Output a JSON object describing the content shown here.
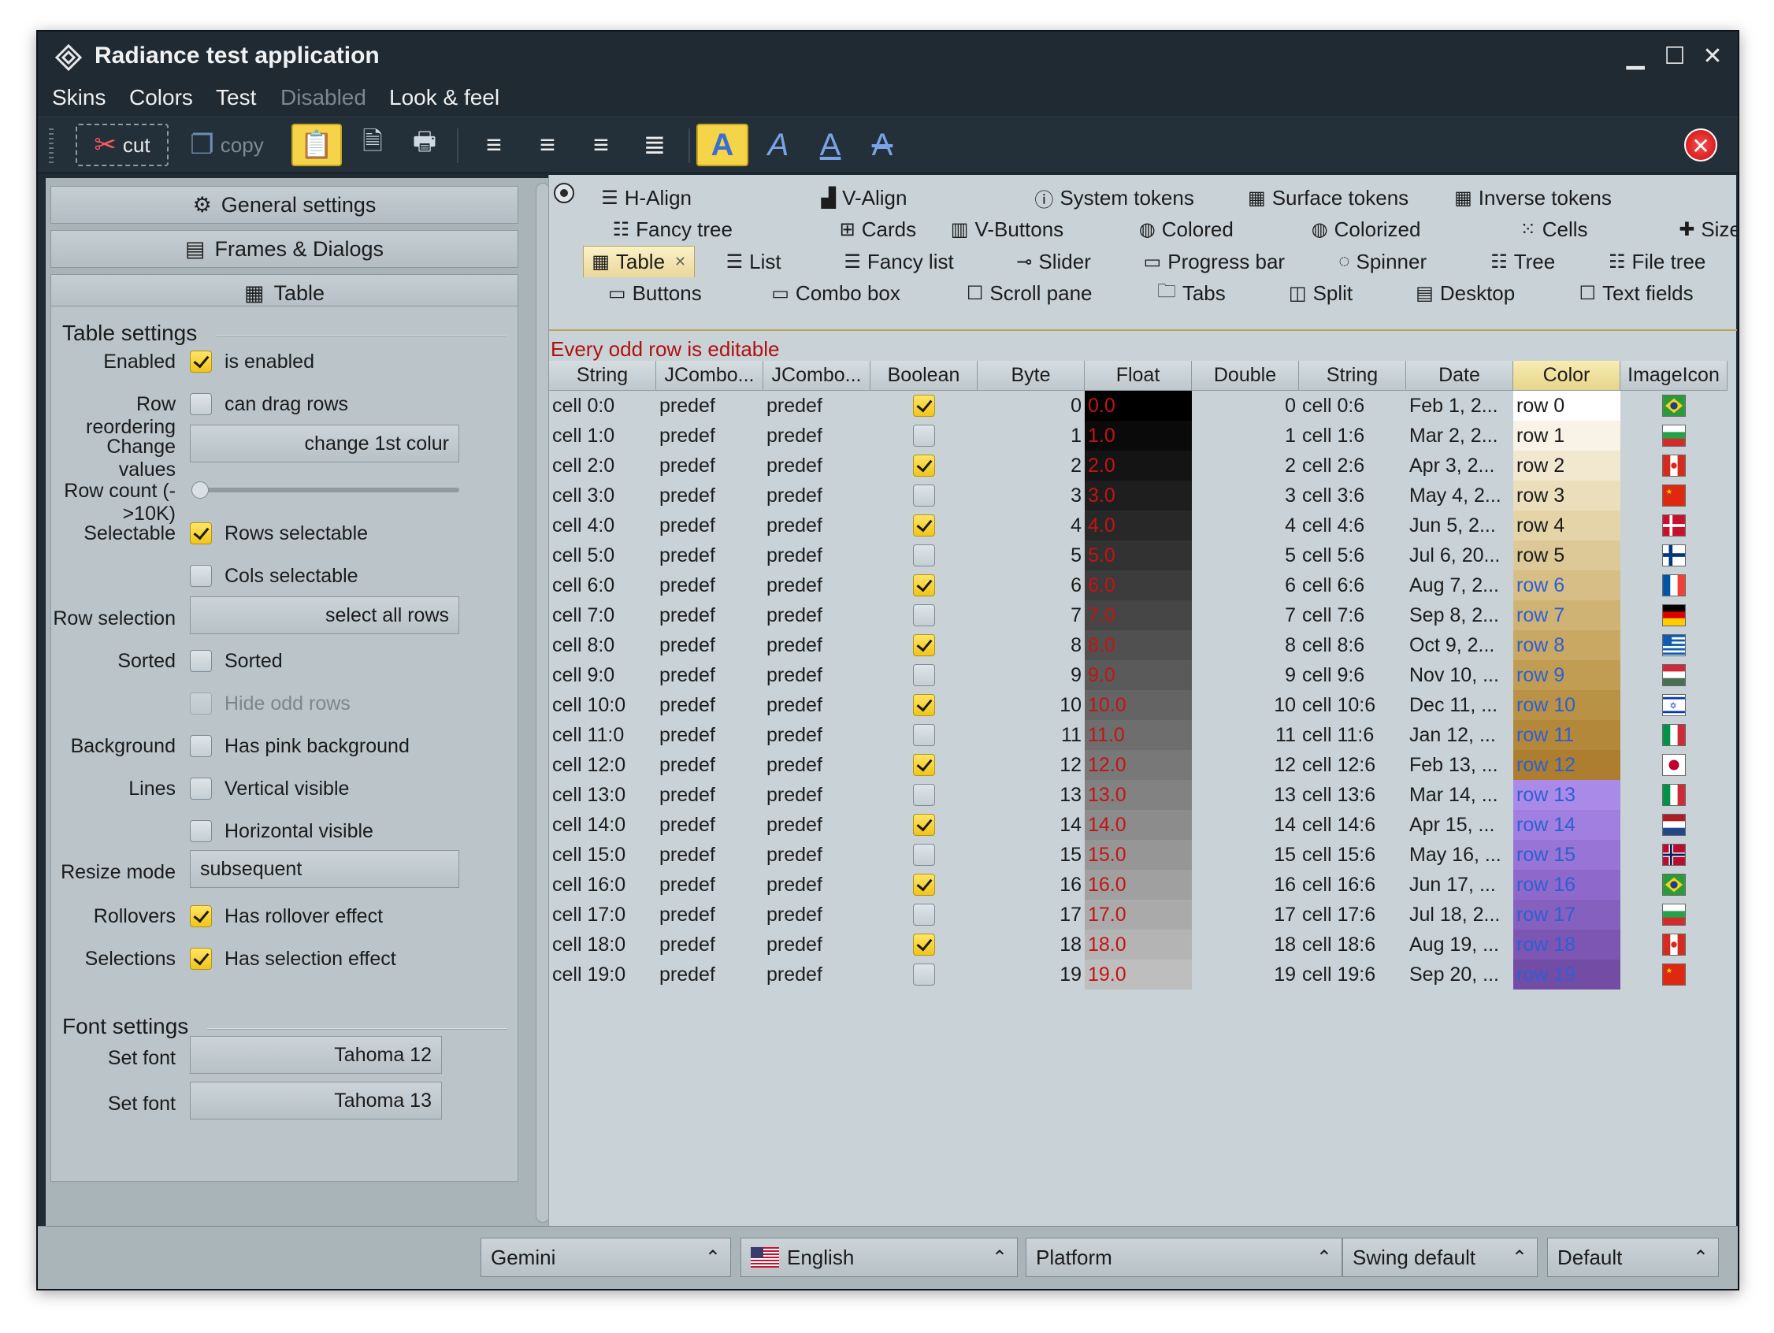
{
  "window": {
    "title": "Radiance test application"
  },
  "menu": [
    "Skins",
    "Colors",
    "Test",
    "Disabled",
    "Look & feel"
  ],
  "toolbar": {
    "cut": "cut",
    "copy": "copy"
  },
  "left": {
    "accordion": [
      "General settings",
      "Frames & Dialogs",
      "Table"
    ],
    "table_settings_title": "Table settings",
    "font_settings_title": "Font settings",
    "rows": [
      {
        "label": "Enabled",
        "type": "cb",
        "checked": true,
        "text": "is enabled"
      },
      {
        "label": "Row reordering",
        "type": "cb",
        "checked": false,
        "text": "can drag rows"
      },
      {
        "label": "Change values",
        "type": "btn",
        "text": "change 1st colur"
      },
      {
        "label": "Row count (->10K)",
        "type": "slider"
      },
      {
        "label": "Selectable",
        "type": "cb",
        "checked": true,
        "text": "Rows selectable"
      },
      {
        "label": "",
        "type": "cb",
        "checked": false,
        "text": "Cols selectable"
      },
      {
        "label": "Row selection",
        "type": "btn",
        "text": "select all rows"
      },
      {
        "label": "Sorted",
        "type": "cb",
        "checked": false,
        "text": "Sorted"
      },
      {
        "label": "",
        "type": "cb",
        "checked": false,
        "disabled": true,
        "text": "Hide odd rows"
      },
      {
        "label": "Background",
        "type": "cb",
        "checked": false,
        "text": "Has pink background"
      },
      {
        "label": "Lines",
        "type": "cb",
        "checked": false,
        "text": "Vertical visible"
      },
      {
        "label": "",
        "type": "cb",
        "checked": false,
        "text": "Horizontal visible"
      },
      {
        "label": "Resize mode",
        "type": "combo",
        "text": "subsequent"
      },
      {
        "label": "Rollovers",
        "type": "cb",
        "checked": true,
        "text": "Has rollover effect"
      },
      {
        "label": "Selections",
        "type": "cb",
        "checked": true,
        "text": "Has selection effect"
      }
    ],
    "fonts": [
      {
        "label": "Set font",
        "text": "Tahoma 12"
      },
      {
        "label": "Set font",
        "text": "Tahoma 13"
      }
    ]
  },
  "tabs": [
    [
      {
        "ic": "☰",
        "label": "H-Align"
      },
      {
        "ic": "▟",
        "label": "V-Align"
      },
      {
        "ic": "ⓘ",
        "label": "System tokens"
      },
      {
        "ic": "▦",
        "label": "Surface tokens"
      },
      {
        "ic": "▦",
        "label": "Inverse tokens"
      }
    ],
    [
      {
        "ic": "☷",
        "label": "Fancy tree"
      },
      {
        "ic": "⊞",
        "label": "Cards"
      },
      {
        "ic": "▥",
        "label": "V-Buttons"
      },
      {
        "ic": "◍",
        "label": "Colored"
      },
      {
        "ic": "◍",
        "label": "Colorized"
      },
      {
        "ic": "⁙",
        "label": "Cells"
      },
      {
        "ic": "✚",
        "label": "Sizes"
      }
    ],
    [
      {
        "ic": "▦",
        "label": "Table",
        "selected": true
      },
      {
        "ic": "☰",
        "label": "List"
      },
      {
        "ic": "☰",
        "label": "Fancy list"
      },
      {
        "ic": "⊸",
        "label": "Slider"
      },
      {
        "ic": "▭",
        "label": "Progress bar"
      },
      {
        "ic": "◌",
        "label": "Spinner"
      },
      {
        "ic": "☷",
        "label": "Tree"
      },
      {
        "ic": "☷",
        "label": "File tree"
      }
    ],
    [
      {
        "ic": "▭",
        "label": "Buttons"
      },
      {
        "ic": "▭",
        "label": "Combo box"
      },
      {
        "ic": "☐",
        "label": "Scroll pane"
      },
      {
        "ic": "🗀",
        "label": "Tabs"
      },
      {
        "ic": "◫",
        "label": "Split"
      },
      {
        "ic": "▤",
        "label": "Desktop"
      },
      {
        "ic": "☐",
        "label": "Text fields"
      }
    ]
  ],
  "note": "Every odd row is editable",
  "table": {
    "headers": [
      "String",
      "JCombo...",
      "JCombo...",
      "Boolean",
      "Byte",
      "Float",
      "Double",
      "String",
      "Date",
      "Color",
      "ImageIcon"
    ],
    "dates": [
      "Feb 1, 2...",
      "Mar 2, 2...",
      "Apr 3, 2...",
      "May 4, 2...",
      "Jun 5, 2...",
      "Jul 6, 20...",
      "Aug 7, 2...",
      "Sep 8, 2...",
      "Oct 9, 2...",
      "Nov 10, ...",
      "Dec 11, ...",
      "Jan 12, ...",
      "Feb 13, ...",
      "Mar 14, ...",
      "Apr 15, ...",
      "May 16, ...",
      "Jun 17, ...",
      "Jul 18, 2...",
      "Aug 19, ...",
      "Sep 20, ..."
    ],
    "color_cells": [
      "#ffffff",
      "#f8f3e6",
      "#f1e8cf",
      "#eadebb",
      "#e4d4a8",
      "#ddc997",
      "#d6be86",
      "#cfb374",
      "#c8a863",
      "#c19d54",
      "#ba9246",
      "#b3883a",
      "#ad7e2f",
      "#a98ae8",
      "#a07fe0",
      "#9774d6",
      "#8e69cb",
      "#8560bf",
      "#7c56b2",
      "#734ca5"
    ],
    "flags": [
      "br",
      "bg",
      "ca",
      "cn",
      "dk",
      "fi",
      "fr",
      "de",
      "gr",
      "hu",
      "il",
      "it",
      "jp",
      "it",
      "nl",
      "no",
      "br",
      "bg",
      "ca",
      "cn"
    ]
  },
  "footer": {
    "skin": "Gemini",
    "language": "English",
    "platform": "Platform",
    "swing": "Swing default",
    "default": "Default"
  }
}
